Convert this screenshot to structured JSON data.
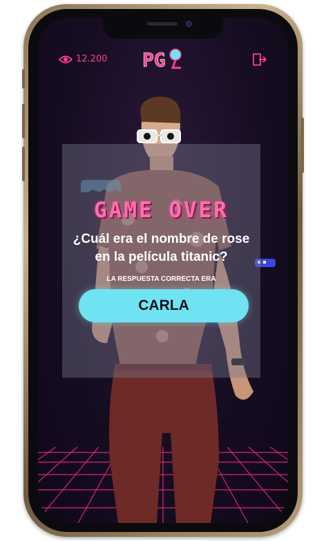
{
  "header": {
    "view_count": "12.200",
    "logo_text": "PG"
  },
  "game": {
    "status_title": "GAME OVER",
    "question": "¿Cuál era el nombre de rose en la película titanic?",
    "answer_label": "LA RESPUESTA CORRECTA ERA",
    "answer": "CARLA"
  },
  "colors": {
    "accent_pink": "#ff3d8e",
    "answer_cyan": "#6fe3f2",
    "screen_bg": "#170d22"
  },
  "icons": {
    "views": "eye-icon",
    "exit": "exit-door-icon"
  }
}
